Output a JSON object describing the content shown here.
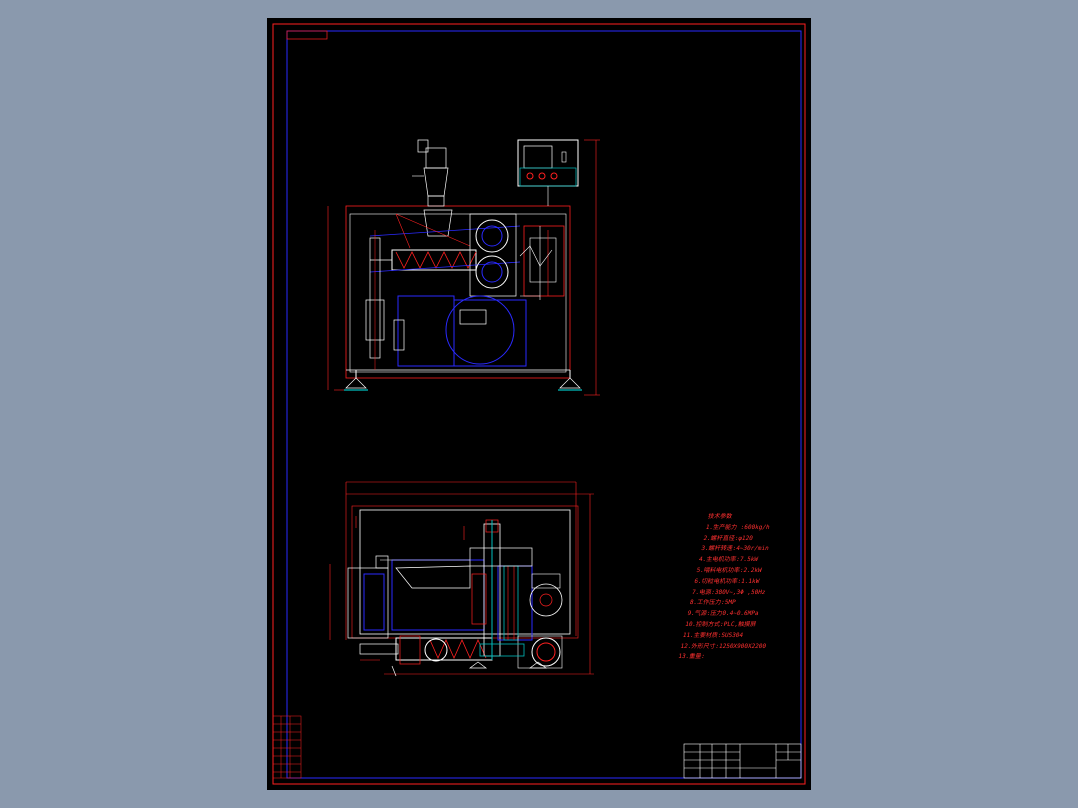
{
  "tech_spec": {
    "heading": "技术参数",
    "items": [
      "1.生产能力 :600kg/h",
      "2.螺杆直径:φ120",
      "3.螺杆转速:4~30r/min",
      "4.主电机功率:7.5kW",
      "5.喂料电机功率:2.2kW",
      "6.切粒电机功率:1.1kW",
      "7.电源:380V~,3Φ ,50Hz",
      "8.工作压力:5MP",
      "9.气源:压力0.4~0.6MPa",
      "10.控制方式:PLC,触摸屏",
      "11.主要材质:SUS304",
      "12.外形尺寸:1250X900X2200",
      "13.重量:"
    ]
  },
  "colors": {
    "background": "#8a99ad",
    "sheet": "#000000",
    "outline": "#ff2020",
    "frame": "#2a2aff",
    "detail": "#ffffff",
    "accent": "#00c0c0"
  }
}
